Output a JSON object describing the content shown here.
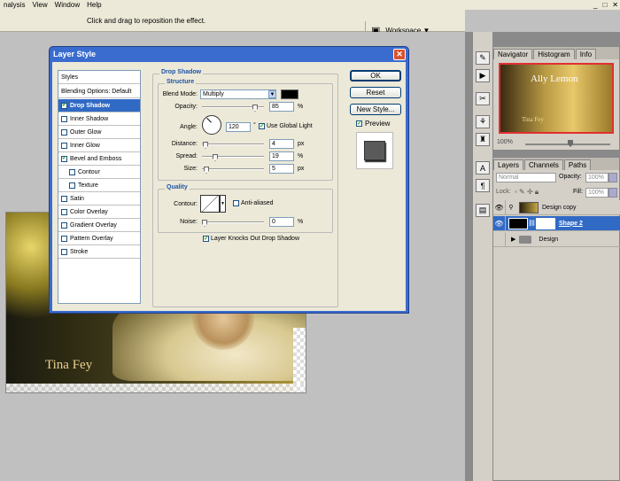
{
  "menu": {
    "items": [
      "nalysis",
      "View",
      "Window",
      "Help"
    ],
    "win_min": "_",
    "win_max": "□",
    "win_close": "✕"
  },
  "options_bar": {
    "hint": "Click and drag to reposition the effect.",
    "workspace": "Workspace ▼"
  },
  "document": {
    "caption": "Tina Fey"
  },
  "dialog": {
    "title": "Layer Style",
    "close": "✕",
    "styles_header": "Styles",
    "blending_options": "Blending Options: Default",
    "styles": [
      {
        "label": "Drop Shadow",
        "checked": true,
        "selected": true
      },
      {
        "label": "Inner Shadow",
        "checked": false
      },
      {
        "label": "Outer Glow",
        "checked": false
      },
      {
        "label": "Inner Glow",
        "checked": false
      },
      {
        "label": "Bevel and Emboss",
        "checked": true
      },
      {
        "label": "Contour",
        "checked": false,
        "indent": true
      },
      {
        "label": "Texture",
        "checked": false,
        "indent": true
      },
      {
        "label": "Satin",
        "checked": false
      },
      {
        "label": "Color Overlay",
        "checked": false
      },
      {
        "label": "Gradient Overlay",
        "checked": false
      },
      {
        "label": "Pattern Overlay",
        "checked": false
      },
      {
        "label": "Stroke",
        "checked": false
      }
    ],
    "section_title": "Drop Shadow",
    "structure": {
      "title": "Structure",
      "blend_mode_label": "Blend Mode:",
      "blend_mode": "Multiply",
      "shadow_color": "#000000",
      "opacity_label": "Opacity:",
      "opacity": "85",
      "opacity_fraction": 0.85,
      "angle_label": "Angle:",
      "angle": "120",
      "use_global_light": "Use Global Light",
      "distance_label": "Distance:",
      "distance": "4",
      "spread_label": "Spread:",
      "spread": "19",
      "size_label": "Size:",
      "size": "5",
      "unit_px": "px",
      "unit_pct": "%",
      "unit_deg": "°"
    },
    "quality": {
      "title": "Quality",
      "contour_label": "Contour:",
      "anti_aliased": "Anti-aliased",
      "noise_label": "Noise:",
      "noise": "0"
    },
    "knockout": "Layer Knocks Out Drop Shadow",
    "buttons": {
      "ok": "OK",
      "reset": "Reset",
      "new_style": "New Style...",
      "preview": "Preview"
    }
  },
  "navigator": {
    "tabs": [
      "Navigator",
      "Histogram",
      "Info"
    ],
    "thumb_text": "Ally Lemon",
    "thumb_caption": "Tina Fey",
    "zoom": "100%"
  },
  "layers_panel": {
    "tabs": [
      "Layers",
      "Channels",
      "Paths"
    ],
    "blend_mode": "Normal",
    "opacity_label": "Opacity:",
    "opacity": "100%",
    "lock_label": "Lock:",
    "fill_label": "Fill:",
    "fill": "100%",
    "layers": [
      {
        "name": "Design copy",
        "selected": false
      },
      {
        "name": "Shape 2",
        "selected": true
      },
      {
        "name": "Design",
        "selected": false,
        "group": true
      }
    ]
  }
}
